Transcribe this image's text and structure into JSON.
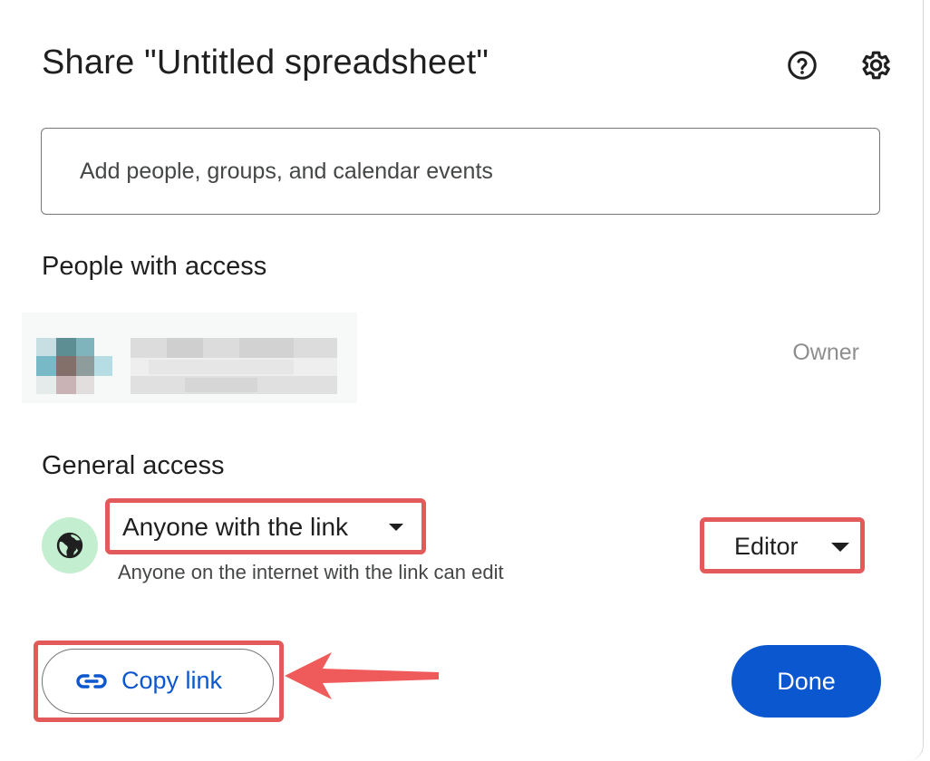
{
  "dialog": {
    "title": "Share \"Untitled spreadsheet\"",
    "help_icon": "help-circle-icon",
    "settings_icon": "gear-icon"
  },
  "search": {
    "placeholder": "Add people, groups, and calendar events",
    "value": ""
  },
  "people": {
    "heading": "People with access",
    "items": [
      {
        "role": "Owner",
        "avatar": "pixelated-avatar"
      }
    ]
  },
  "general_access": {
    "heading": "General access",
    "icon": "globe-icon",
    "link_setting": "Anyone with the link",
    "description": "Anyone on the internet with the link can edit",
    "role": "Editor"
  },
  "footer": {
    "copy_link_label": "Copy link",
    "copy_link_icon": "link-icon",
    "done_label": "Done"
  },
  "colors": {
    "accent": "#0b57d0",
    "highlight": "#e35a5a",
    "globe_bg": "#c4eed0"
  }
}
